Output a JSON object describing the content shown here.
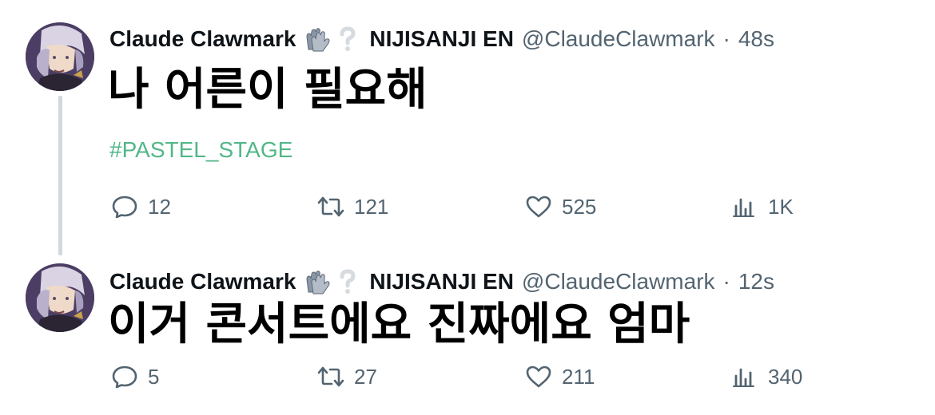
{
  "tweets": [
    {
      "display_name": "Claude Clawmark",
      "org": "NIJISANJI EN",
      "handle": "@ClaudeClawmark",
      "separator": "·",
      "time": "48s",
      "text": "나 어른이 필요해",
      "hashtag": "#PASTEL_STAGE",
      "reply_count": "12",
      "retweet_count": "121",
      "like_count": "525",
      "views_count": "1K"
    },
    {
      "display_name": "Claude Clawmark",
      "org": "NIJISANJI EN",
      "handle": "@ClaudeClawmark",
      "separator": "·",
      "time": "12s",
      "text": "이거 콘서트에요 진짜에요 엄마",
      "reply_count": "5",
      "retweet_count": "27",
      "like_count": "211",
      "views_count": "340"
    }
  ],
  "icons": {
    "name_emoji_1": "gloves-emoji",
    "name_emoji_2": "white-question-mark-emoji",
    "reply": "reply-icon",
    "retweet": "retweet-icon",
    "like": "heart-icon",
    "views": "views-icon"
  },
  "colors": {
    "hashtag": "#52b788",
    "muted": "#536471",
    "thread_line": "#cfd9de"
  }
}
